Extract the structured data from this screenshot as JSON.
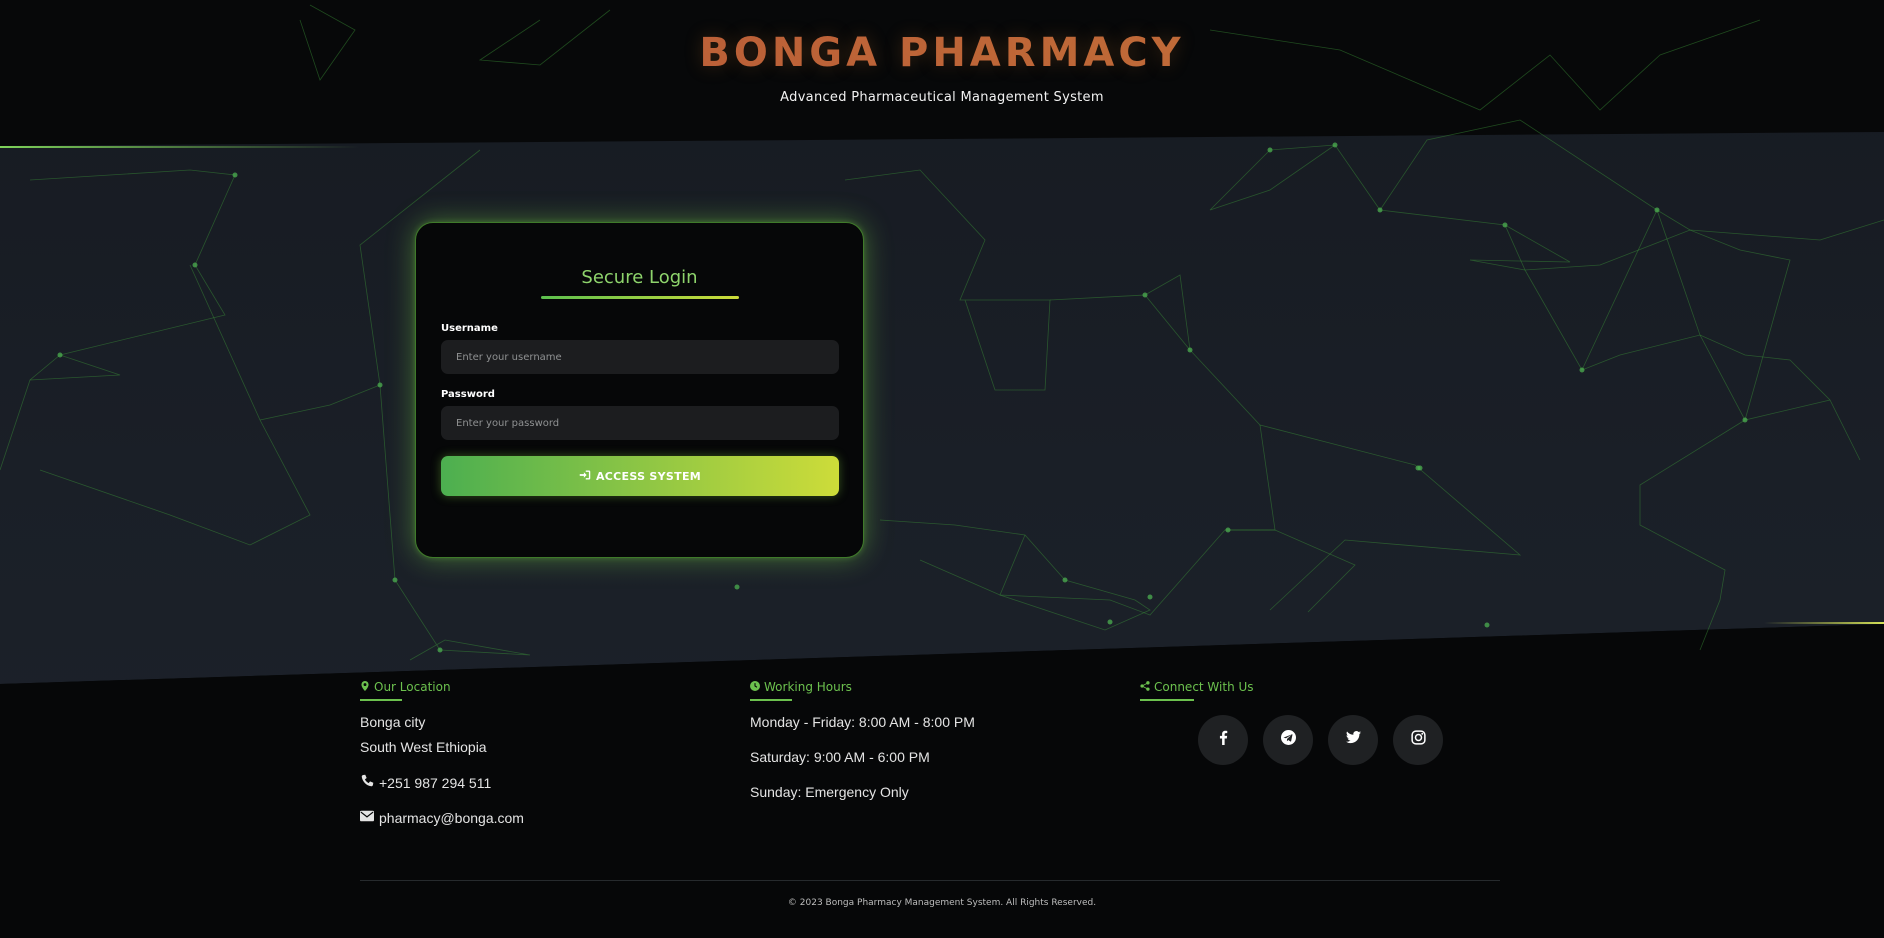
{
  "brand": {
    "title": "BONGA PHARMACY",
    "subtitle": "Advanced Pharmaceutical Management System"
  },
  "login": {
    "title": "Secure Login",
    "username_label": "Username",
    "username_placeholder": "Enter your username",
    "username_value": "",
    "password_label": "Password",
    "password_placeholder": "Enter your password",
    "password_value": "",
    "submit_label": "ACCESS SYSTEM",
    "submit_icon": "sign-in-icon"
  },
  "footer": {
    "location": {
      "heading": "Our Location",
      "icon": "map-marker-icon",
      "city": "Bonga city",
      "region": "South West Ethiopia",
      "phone": "+251 987 294 511",
      "email": "pharmacy@bonga.com"
    },
    "hours": {
      "heading": "Working Hours",
      "icon": "clock-icon",
      "weekdays": "Monday - Friday: 8:00 AM - 8:00 PM",
      "saturday": "Saturday: 9:00 AM - 6:00 PM",
      "sunday": "Sunday: Emergency Only"
    },
    "social": {
      "heading": "Connect With Us",
      "icon": "share-icon",
      "links": [
        "facebook-icon",
        "telegram-icon",
        "twitter-icon",
        "instagram-icon"
      ]
    },
    "copyright": "© 2023 Bonga Pharmacy Management System. All Rights Reserved."
  },
  "colors": {
    "accent_green": "#6cc14e",
    "accent_lime": "#cddc39",
    "brand_orange": "#c6793a",
    "background": "#060708"
  }
}
